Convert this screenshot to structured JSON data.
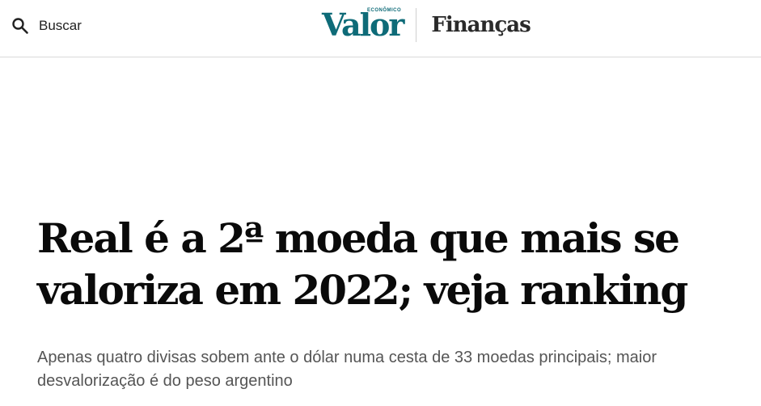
{
  "header": {
    "search_label": "Buscar",
    "search_icon": "search-icon",
    "logo_text": "Valor",
    "logo_subtext": "ECONÔMICO",
    "section": "Finanças",
    "brand_color": "#0e6b78"
  },
  "article": {
    "headline": "Real é a 2ª moeda que mais se valoriza em 2022; veja ranking",
    "subtitle": "Apenas quatro divisas sobem ante o dólar numa cesta de 33 moedas principais; maior desvalorização é do peso argentino"
  }
}
